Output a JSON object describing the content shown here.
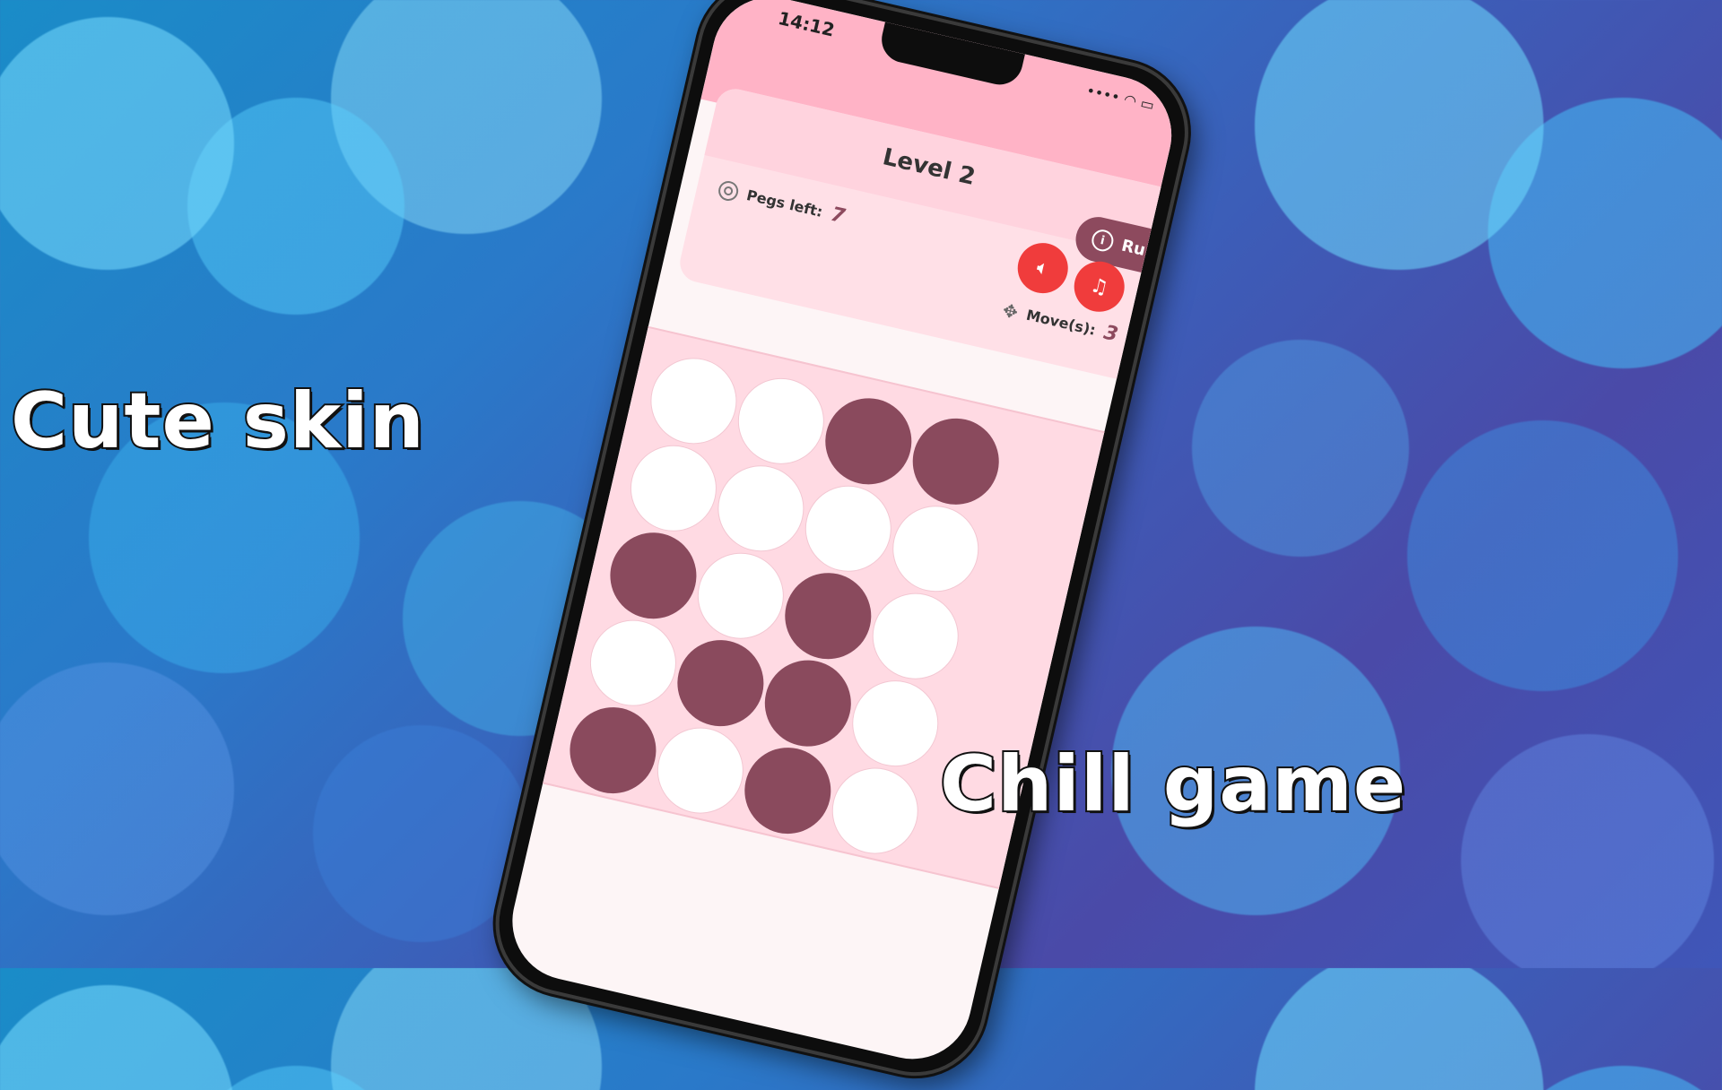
{
  "captions": {
    "left": "Cute skin",
    "right": "Chill game"
  },
  "status_bar": {
    "time": "14:12"
  },
  "header": {
    "title": "Level 2",
    "rules_label": "Rules",
    "pegs_label": "Pegs left:",
    "pegs_value": "7",
    "moves_label": "Move(s):",
    "moves_value": "3"
  },
  "colors": {
    "header_pink": "#ffb3c6",
    "peg_filled": "#8a4a5d",
    "peg_empty": "#ffffff",
    "button_red": "#f03c3c",
    "rules_button": "#8d4a5e"
  },
  "icons": {
    "sound": "speaker-icon",
    "music": "music-note-icon",
    "info": "info-icon",
    "target": "target-icon",
    "move": "move-arrows-icon"
  },
  "board": [
    [
      "empty",
      "empty",
      "filled",
      "filled"
    ],
    [
      "empty",
      "empty",
      "empty",
      "empty"
    ],
    [
      "filled",
      "empty",
      "filled",
      "empty"
    ],
    [
      "empty",
      "filled",
      "filled",
      "empty"
    ],
    [
      "filled",
      "empty",
      "filled",
      "empty"
    ]
  ]
}
